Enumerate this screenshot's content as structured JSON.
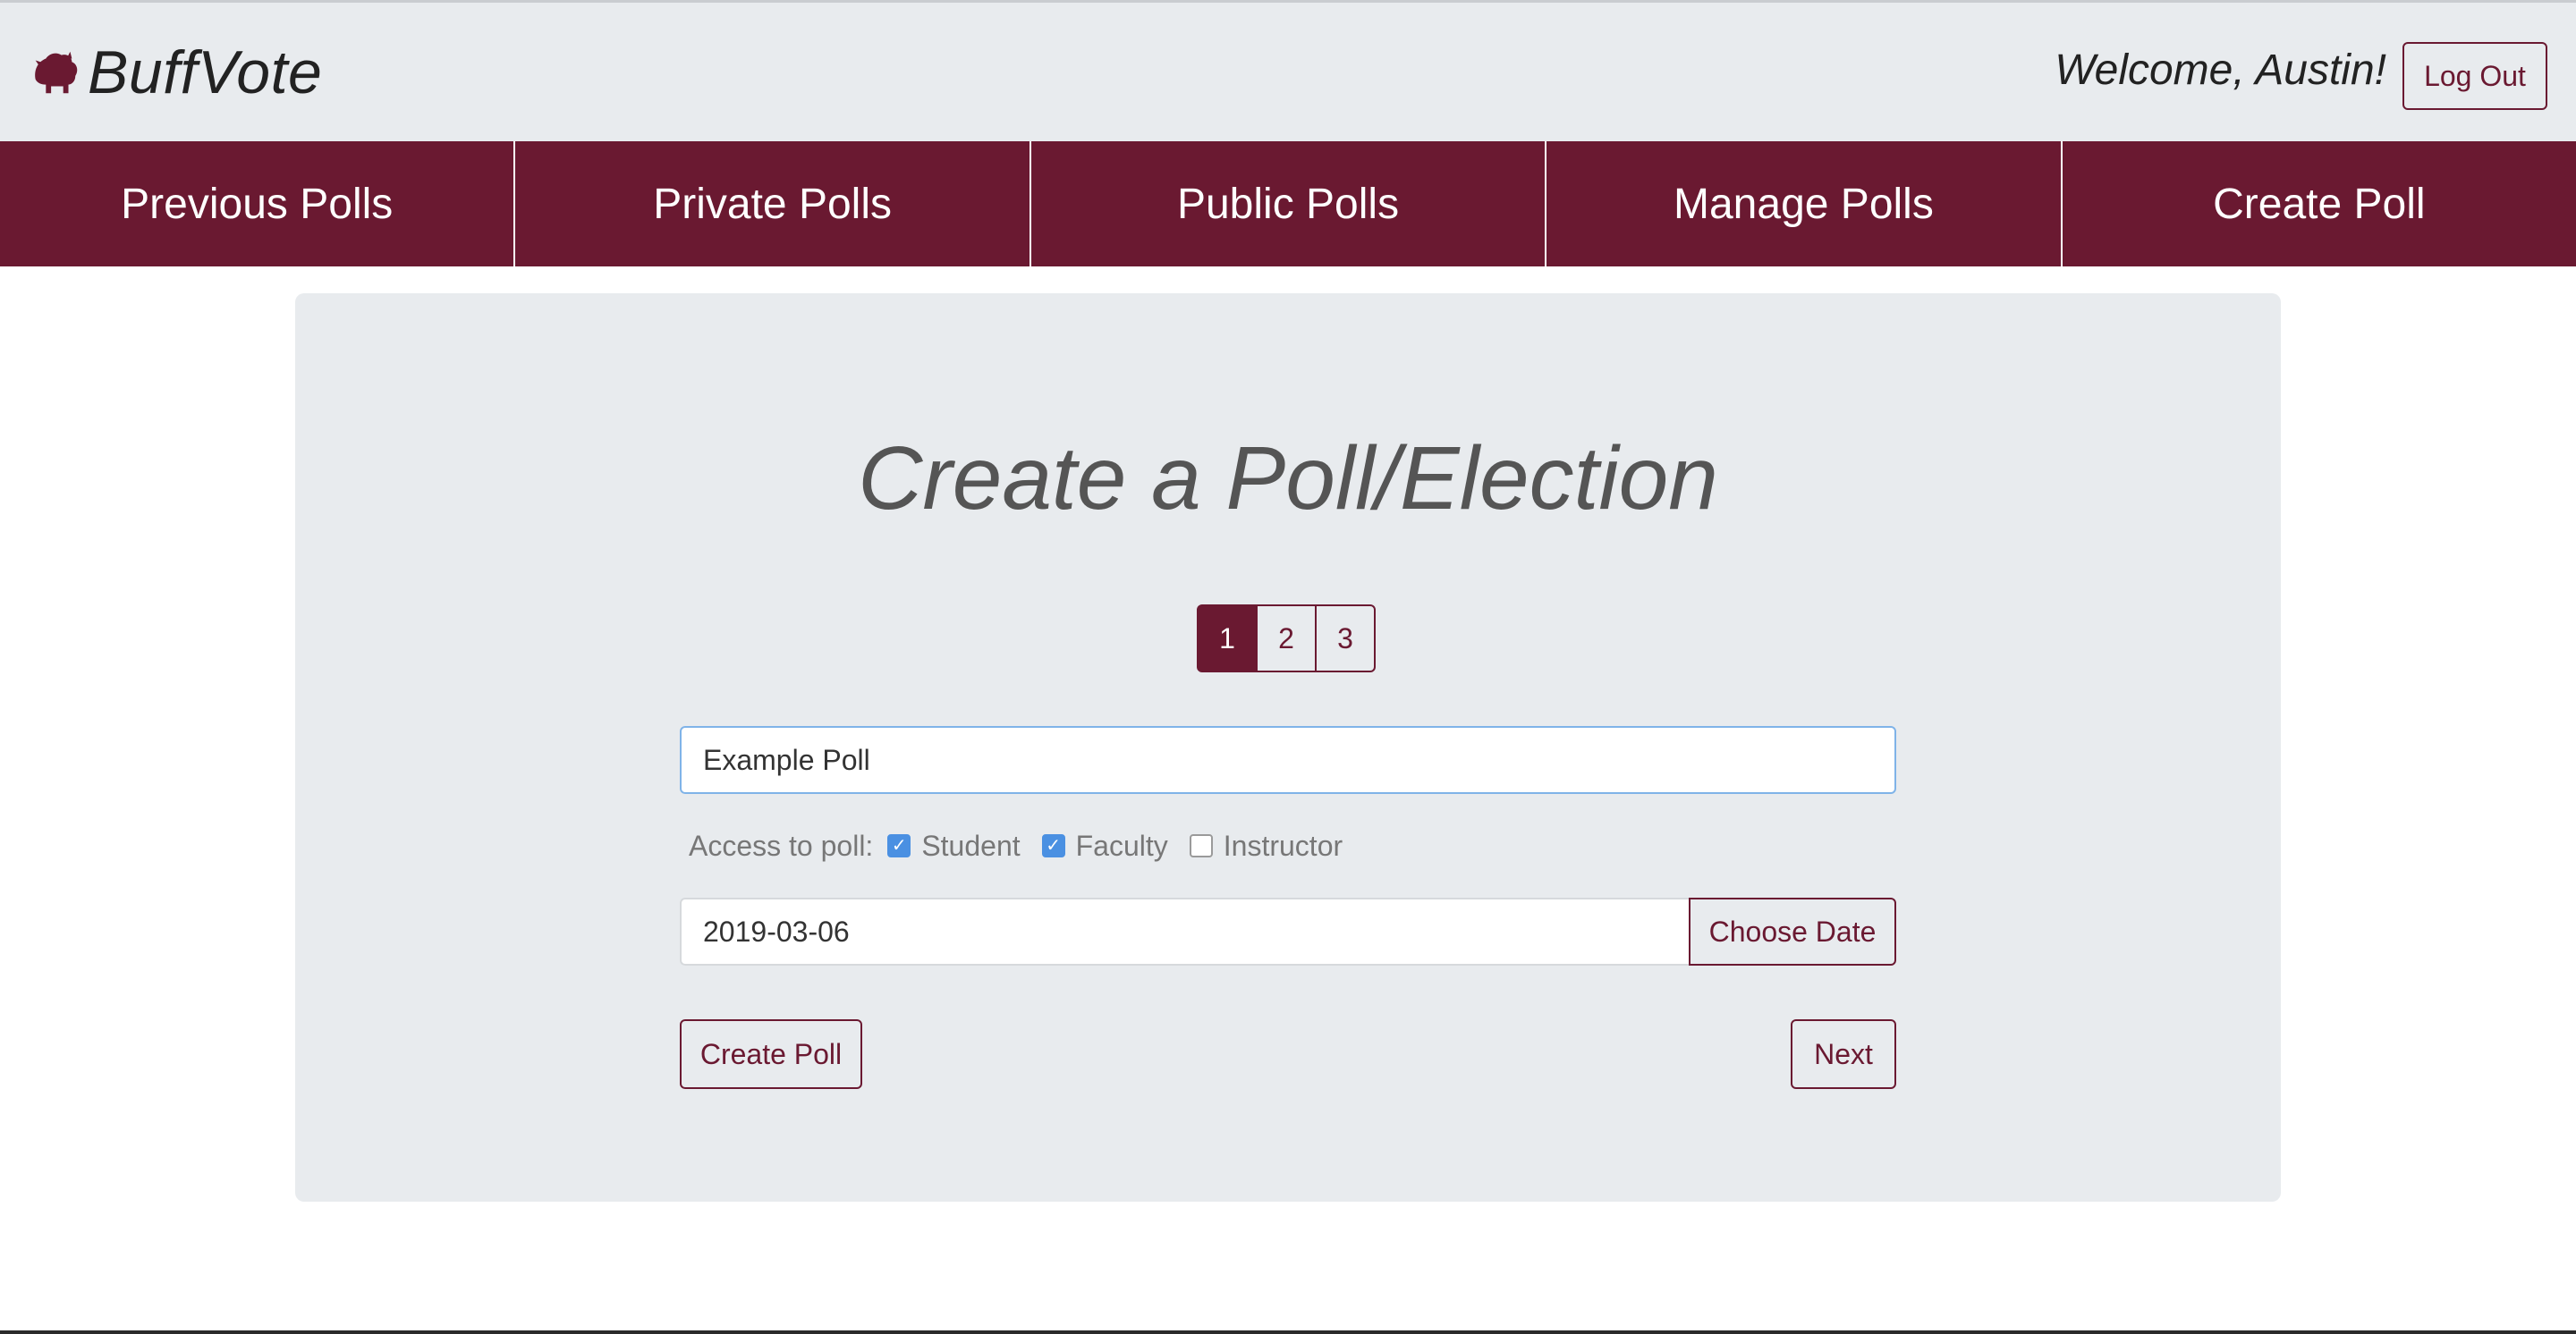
{
  "brand": {
    "name": "BuffVote",
    "logo_icon": "buffalo-logo-icon",
    "accent_color": "#6a1931"
  },
  "header": {
    "welcome_text": "Welcome, Austin!",
    "logout_label": "Log Out"
  },
  "nav": {
    "items": [
      {
        "label": "Previous Polls"
      },
      {
        "label": "Private Polls"
      },
      {
        "label": "Public Polls"
      },
      {
        "label": "Manage Polls"
      },
      {
        "label": "Create Poll"
      }
    ]
  },
  "main": {
    "title": "Create a Poll/Election",
    "steps": [
      {
        "label": "1",
        "active": true
      },
      {
        "label": "2",
        "active": false
      },
      {
        "label": "3",
        "active": false
      }
    ],
    "poll_name_value": "Example Poll",
    "access": {
      "label": "Access to poll:",
      "options": [
        {
          "label": "Student",
          "checked": true
        },
        {
          "label": "Faculty",
          "checked": true
        },
        {
          "label": "Instructor",
          "checked": false
        }
      ]
    },
    "date_value": "2019-03-06",
    "choose_date_label": "Choose Date",
    "create_poll_label": "Create Poll",
    "next_label": "Next"
  }
}
